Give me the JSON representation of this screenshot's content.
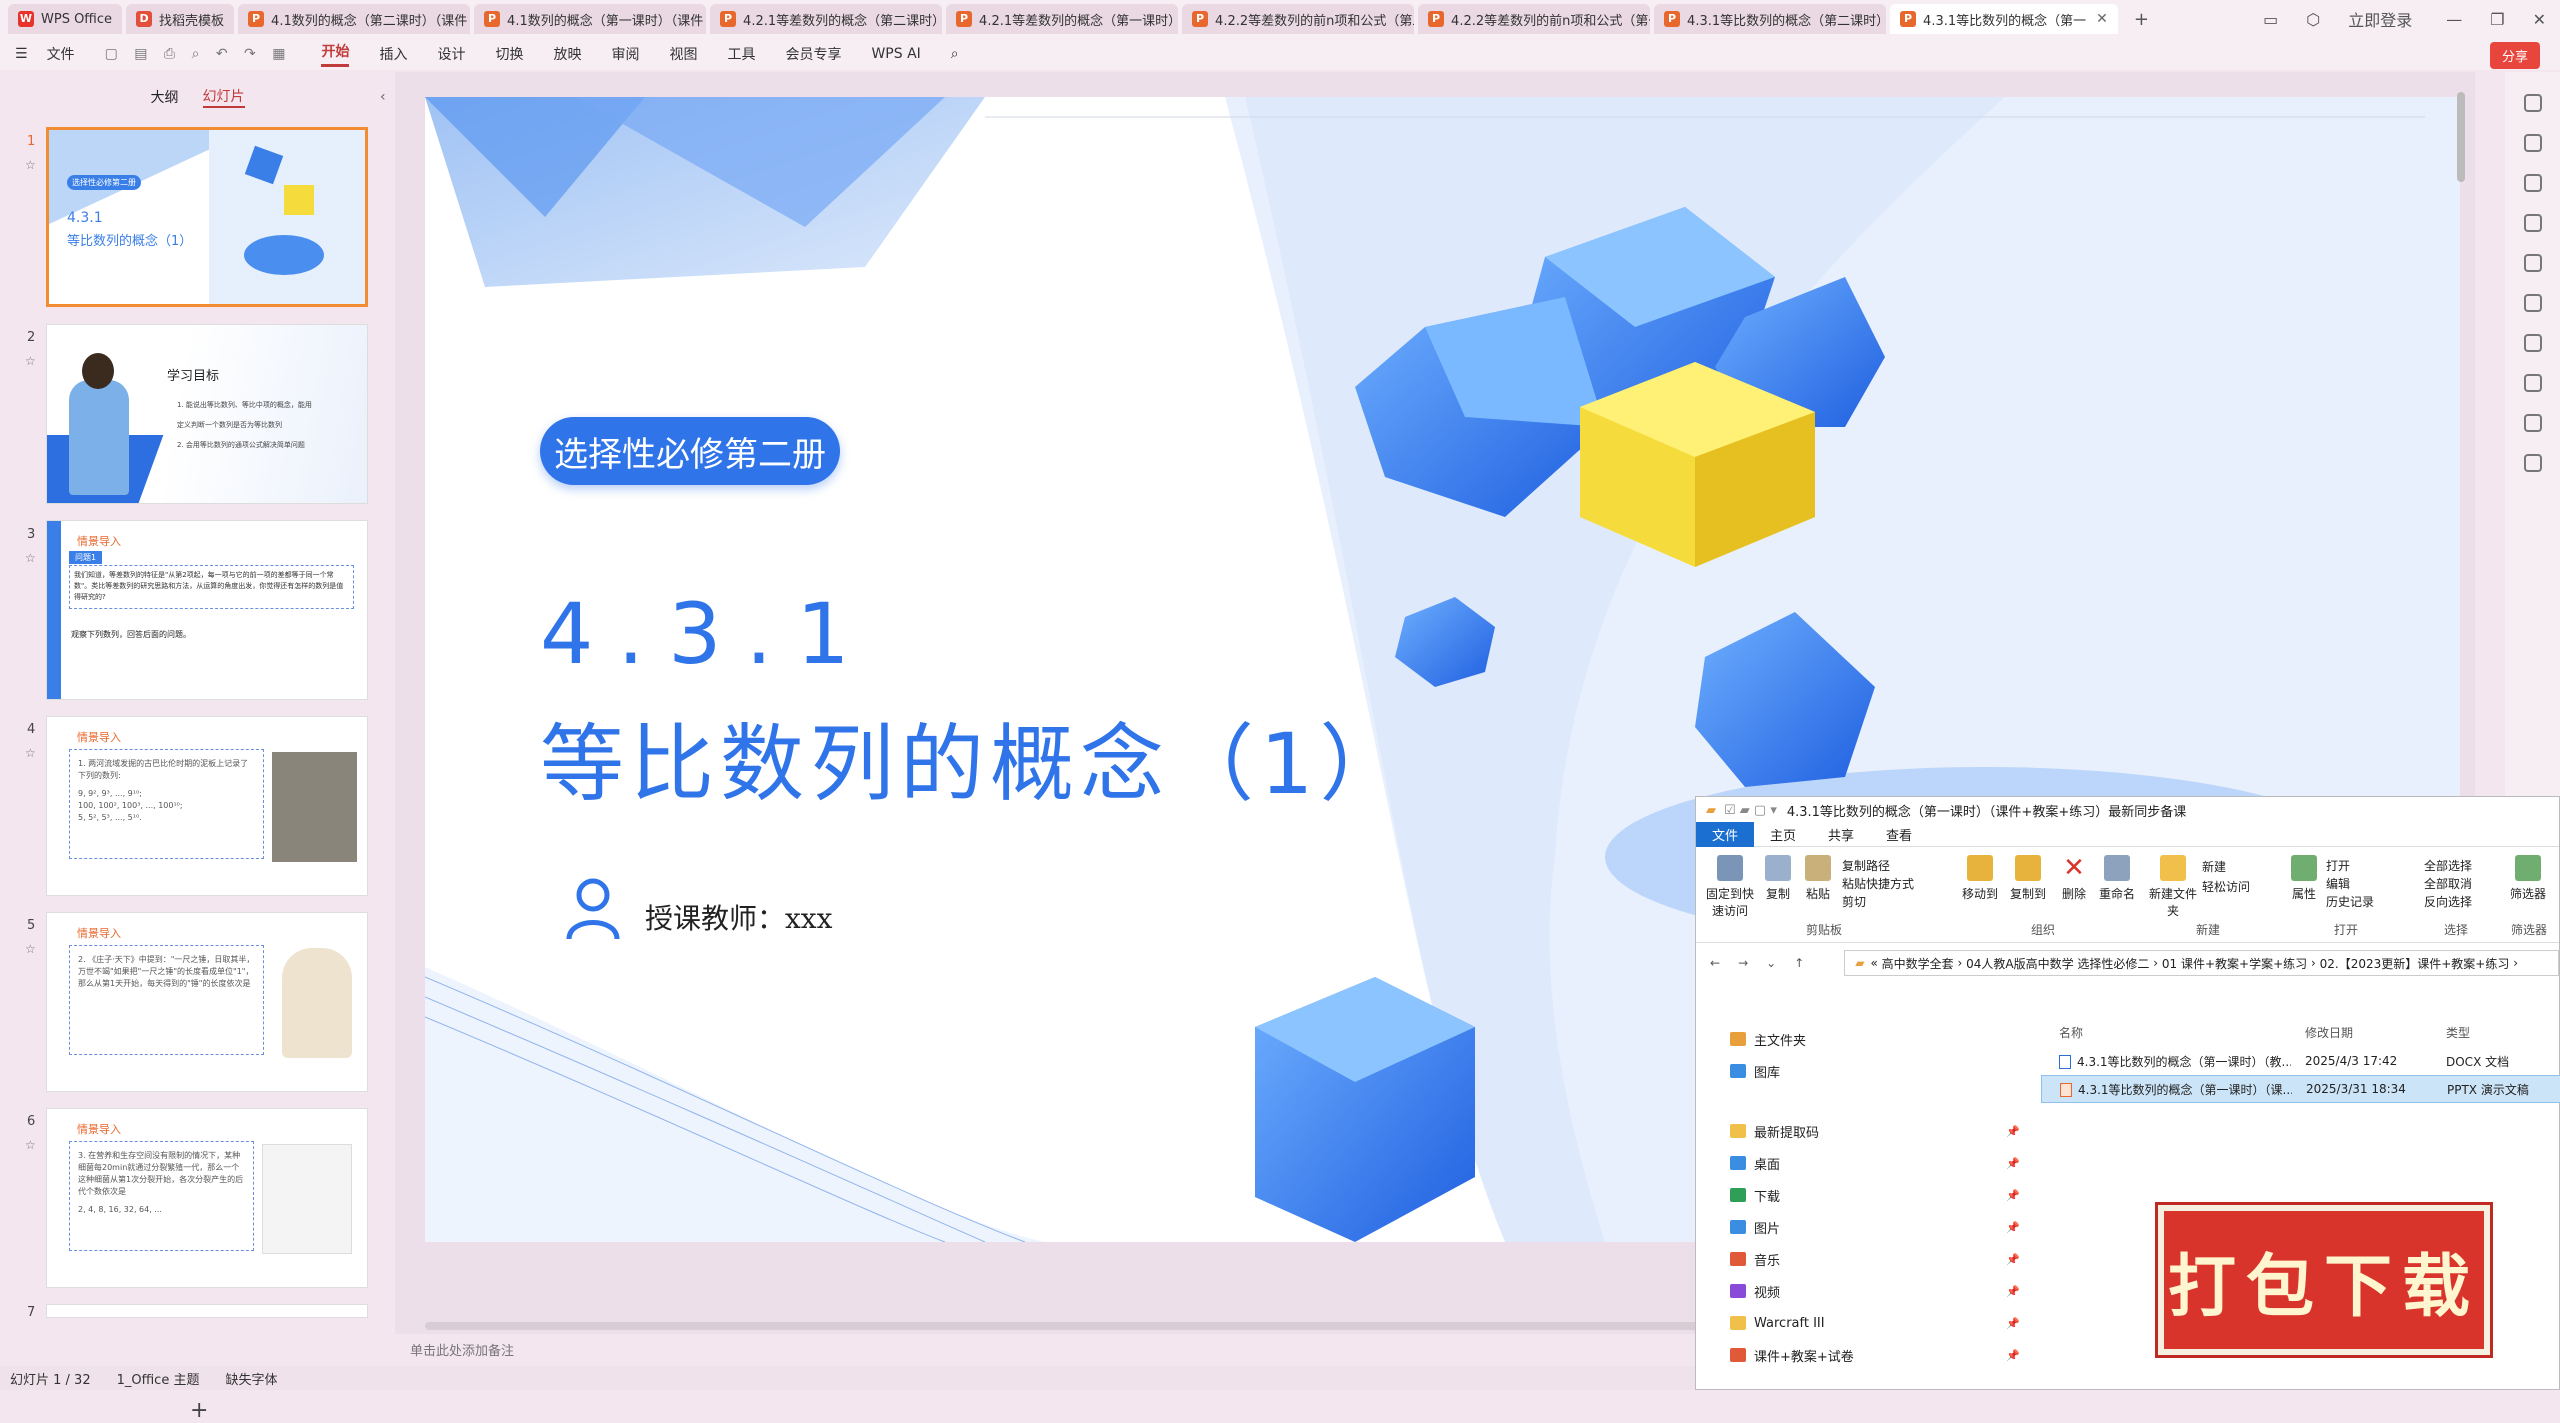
{
  "tabs": [
    {
      "label": "WPS Office",
      "icon": "wps-logo-icon"
    },
    {
      "label": "找稻壳模板",
      "icon": "docer-icon"
    },
    {
      "label": "4.1数列的概念（第二课时）（课件",
      "icon": "pptx-icon"
    },
    {
      "label": "4.1数列的概念（第一课时）（课件",
      "icon": "pptx-icon"
    },
    {
      "label": "4.2.1等差数列的概念（第二课时）",
      "icon": "pptx-icon"
    },
    {
      "label": "4.2.1等差数列的概念（第一课时）",
      "icon": "pptx-icon"
    },
    {
      "label": "4.2.2等差数列的前n项和公式（第二",
      "icon": "pptx-icon"
    },
    {
      "label": "4.2.2等差数列的前n项和公式（第一",
      "icon": "pptx-icon"
    },
    {
      "label": "4.3.1等比数列的概念（第二课时）",
      "icon": "pptx-icon"
    },
    {
      "label": "4.3.1等比数列的概念（第一",
      "icon": "pptx-icon",
      "active": true
    }
  ],
  "login": "立即登录",
  "menu": [
    "文件",
    "开始",
    "插入",
    "设计",
    "切换",
    "放映",
    "审阅",
    "视图",
    "工具",
    "会员专享",
    "WPS AI"
  ],
  "share": "分享",
  "sidebar": {
    "tab_outline": "大纲",
    "tab_slides": "幻灯片"
  },
  "thumbs": [
    {
      "num": "1",
      "badge": "选择性必修第二册",
      "title1": "4.3.1",
      "title2": "等比数列的概念（1）"
    },
    {
      "num": "2",
      "title": "学习目标",
      "l1": "1. 能说出等比数列、等比中项的概念，能用",
      "l2": "定义判断一个数列是否为等比数列",
      "l3": "2. 会用等比数列的通项公式解决简单问题"
    },
    {
      "num": "3",
      "head": "情景导入",
      "q": "问题1",
      "text": "我们知道，等差数列的特征是\"从第2项起，每一项与它的前一项的差都等于同一个常数\"。类比等差数列的研究思路和方法，从运算的角度出发，你觉得还有怎样的数列是值得研究的?",
      "foot": "观察下列数列，回答后面的问题。"
    },
    {
      "num": "4",
      "head": "情景导入",
      "text": "1. 两河流域发掘的古巴比伦时期的泥板上记录了下列的数列:",
      "r1": "9, 9², 9³, ..., 9¹⁰;",
      "r2": "100, 100², 100³, ..., 100¹⁰;",
      "r3": "5, 5², 5³, ..., 5¹⁰."
    },
    {
      "num": "5",
      "head": "情景导入",
      "text": "2. 《庄子·天下》中提到：\"一尺之锤，日取其半，万世不竭\"如果把\"一尺之锤\"的长度看成单位\"1\"，那么从第1天开始，每天得到的\"锤\"的长度依次是"
    },
    {
      "num": "6",
      "head": "情景导入",
      "text": "3. 在营养和生存空间没有限制的情况下，某种细菌每20min就通过分裂繁殖一代，那么一个这种细菌从第1次分裂开始，各次分裂产生的后代个数依次是",
      "r1": "2, 4, 8, 16, 32, 64, ..."
    },
    {
      "num": "7"
    }
  ],
  "slide": {
    "badge": "选择性必修第二册",
    "title1": "4.3.1",
    "title2": "等比数列的概念（1）",
    "teacher": "授课教师：xxx"
  },
  "notes": "单击此处添加备注",
  "status": {
    "slide": "幻灯片 1 / 32",
    "theme": "1_Office 主题",
    "font": "缺失字体"
  },
  "explorer": {
    "title": "4.3.1等比数列的概念（第一课时）（课件+教案+练习）最新同步备课",
    "tabs": [
      "文件",
      "主页",
      "共享",
      "查看"
    ],
    "ribbon": {
      "pin": "固定到快速访问",
      "copy": "复制",
      "paste": "粘贴",
      "copypath": "复制路径",
      "pasteshortcut": "粘贴快捷方式",
      "cut": "剪切",
      "moveto": "移动到",
      "copyto": "复制到",
      "delete": "删除",
      "rename": "重命名",
      "newfolder": "新建文件夹",
      "newitem": "新建",
      "easyaccess": "轻松访问",
      "props": "属性",
      "open": "打开",
      "edit": "编辑",
      "history": "历史记录",
      "selectall": "全部选择",
      "selectnone": "全部取消",
      "invert": "反向选择",
      "filter": "筛选器",
      "g_clip": "剪贴板",
      "g_org": "组织",
      "g_new": "新建",
      "g_open": "打开",
      "g_sel": "选择",
      "g_filter": "筛选器"
    },
    "path": [
      "«",
      "高中数学全套",
      "›",
      "04人教A版高中数学 选择性必修二",
      "›",
      "01 课件+教案+学案+练习",
      "›",
      "02.【2023更新】课件+教案+练习",
      "›"
    ],
    "nav": [
      {
        "label": "主文件夹",
        "icon": "home-icon",
        "color": "#e7a03c"
      },
      {
        "label": "图库",
        "icon": "gallery-icon",
        "color": "#3a8de0"
      },
      {
        "label": "最新提取码",
        "icon": "folder-icon",
        "color": "#f0c04a"
      },
      {
        "label": "桌面",
        "icon": "desktop-icon",
        "color": "#3a8de0"
      },
      {
        "label": "下载",
        "icon": "download-icon",
        "color": "#2f9e57"
      },
      {
        "label": "图片",
        "icon": "pictures-icon",
        "color": "#3a8de0"
      },
      {
        "label": "音乐",
        "icon": "music-icon",
        "color": "#e05a3a"
      },
      {
        "label": "视频",
        "icon": "video-icon",
        "color": "#8a4ad9"
      },
      {
        "label": "Warcraft III",
        "icon": "folder-icon",
        "color": "#f0c04a"
      },
      {
        "label": "课件+教案+试卷",
        "icon": "folder-icon",
        "color": "#e05a3a"
      }
    ],
    "cols": [
      "名称",
      "修改日期",
      "类型"
    ],
    "files": [
      {
        "name": "4.3.1等比数列的概念（第一课时）（教...",
        "date": "2025/4/3 17:42",
        "type": "DOCX 文档",
        "color": "#2b6fd6"
      },
      {
        "name": "4.3.1等比数列的概念（第一课时）（课...",
        "date": "2025/3/31 18:34",
        "type": "PPTX 演示文稿",
        "color": "#e8672d",
        "selected": true
      }
    ]
  },
  "stamp": "打包下载"
}
